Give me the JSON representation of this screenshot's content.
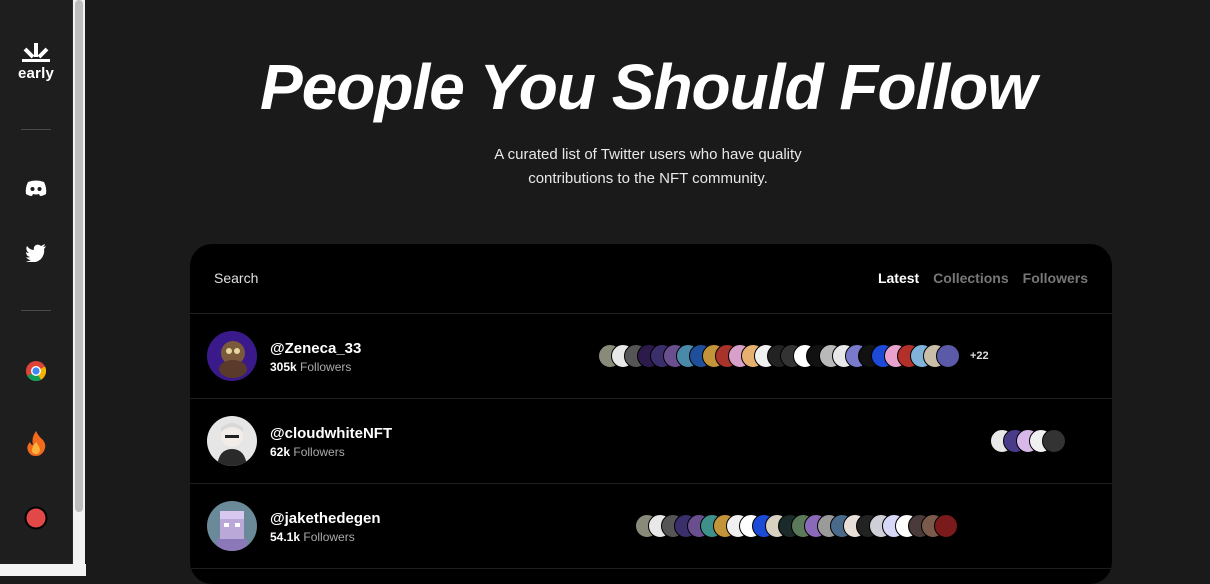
{
  "sidebar": {
    "logo_text": "early",
    "icons": [
      "discord-icon",
      "twitter-icon",
      "chrome-icon",
      "fire-icon",
      "record-icon"
    ]
  },
  "hero": {
    "title": "People You Should Follow",
    "subtitle_line1": "A curated list of Twitter users who have quality",
    "subtitle_line2": "contributions to the NFT community."
  },
  "card": {
    "search_label": "Search",
    "filters": [
      "Latest",
      "Collections",
      "Followers"
    ],
    "active_filter": "Latest"
  },
  "users": [
    {
      "handle": "@Zeneca_33",
      "followers_count": "305k",
      "followers_label": "Followers",
      "more_count": "+22",
      "thumb_colors": [
        "#8a8a7a",
        "#e8e8e8",
        "#555555",
        "#2b1a4a",
        "#3a2e6b",
        "#6a4f8f",
        "#4a89a8",
        "#1f4f9a",
        "#c4943a",
        "#a8332b",
        "#d8a0c8",
        "#e7b070",
        "#f0f0f0",
        "#222222",
        "#333333",
        "#ffffff",
        "#111111",
        "#b9b9b9",
        "#e8e8e8",
        "#7a7acc",
        "#111111",
        "#1c4ad6",
        "#e9a1ce",
        "#b3302a",
        "#7fb3d9",
        "#c9bfa8",
        "#5a5aa8"
      ]
    },
    {
      "handle": "@cloudwhiteNFT",
      "followers_count": "62k",
      "followers_label": "Followers",
      "more_count": "",
      "thumb_colors": [
        "#e8e8e8",
        "#4a3a8a",
        "#d8b8e8",
        "#f0f0f0",
        "#333333"
      ]
    },
    {
      "handle": "@jakethedegen",
      "followers_count": "54.1k",
      "followers_label": "Followers",
      "more_count": "",
      "thumb_colors": [
        "#8a8a7a",
        "#e8e8e8",
        "#555555",
        "#3a2e6b",
        "#6a4f8f",
        "#3f8f8a",
        "#c4943a",
        "#f0f0f0",
        "#ffffff",
        "#1c4ad6",
        "#d8d0c0",
        "#1a2a2a",
        "#5a7a5a",
        "#8a6ab8",
        "#9a9a9a",
        "#4a6a8a",
        "#e8e0d8",
        "#222222",
        "#cfcfd8",
        "#d8d8f8",
        "#ffffff",
        "#4a3a3a",
        "#7a5a4a",
        "#7a1a1a"
      ]
    }
  ]
}
